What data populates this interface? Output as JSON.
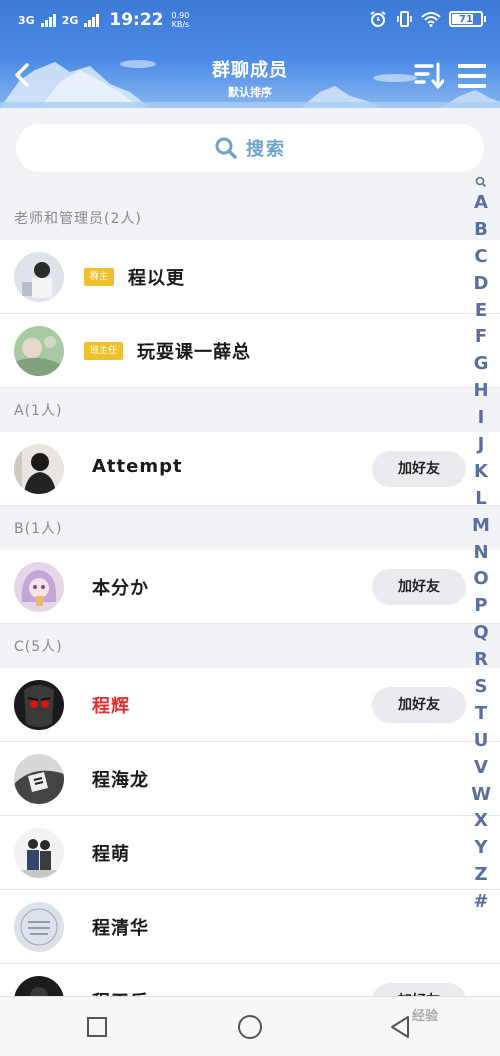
{
  "status_bar": {
    "network_1": "3G",
    "network_2": "2G",
    "time": "19:22",
    "speed_value": "0.90",
    "speed_unit": "KB/s",
    "battery": "71"
  },
  "header": {
    "title": "群聊成员",
    "subtitle": "默认排序",
    "back_icon": "back-arrow-icon",
    "sort_icon": "sort-icon",
    "menu_icon": "menu-icon"
  },
  "search": {
    "label": "搜索",
    "icon": "search-icon"
  },
  "sections": [
    {
      "header": "老师和管理员(2人)",
      "members": [
        {
          "name": "程以更",
          "role": "群主",
          "add_label": ""
        },
        {
          "name": "玩耍课一薛总",
          "role": "班主任",
          "add_label": ""
        }
      ]
    },
    {
      "header": "A(1人)",
      "members": [
        {
          "name": "Attempt",
          "role": "",
          "add_label": "加好友"
        }
      ]
    },
    {
      "header": "B(1人)",
      "members": [
        {
          "name": "本分か",
          "role": "",
          "add_label": "加好友"
        }
      ]
    },
    {
      "header": "C(5人)",
      "members": [
        {
          "name": "程辉",
          "role": "",
          "add_label": "加好友",
          "highlight": "#e23030"
        },
        {
          "name": "程海龙",
          "role": "",
          "add_label": ""
        },
        {
          "name": "程萌",
          "role": "",
          "add_label": ""
        },
        {
          "name": "程清华",
          "role": "",
          "add_label": ""
        },
        {
          "name": "程天乐",
          "role": "",
          "add_label": "加好友"
        }
      ]
    }
  ],
  "alphabet_index": [
    "A",
    "B",
    "C",
    "D",
    "E",
    "F",
    "G",
    "H",
    "I",
    "J",
    "K",
    "L",
    "M",
    "N",
    "O",
    "P",
    "Q",
    "R",
    "S",
    "T",
    "U",
    "V",
    "W",
    "X",
    "Y",
    "Z",
    "#"
  ],
  "bottom_nav": {
    "recent_icon": "square-icon",
    "home_icon": "circle-icon",
    "back_icon": "triangle-back-icon",
    "watermark": "经验"
  },
  "colors": {
    "header_blue": "#3d7ad8",
    "role_badge": "#f0c12e",
    "highlight_red": "#e23030",
    "index_color": "#5a6fa0",
    "search_text": "#6ea4c9"
  }
}
